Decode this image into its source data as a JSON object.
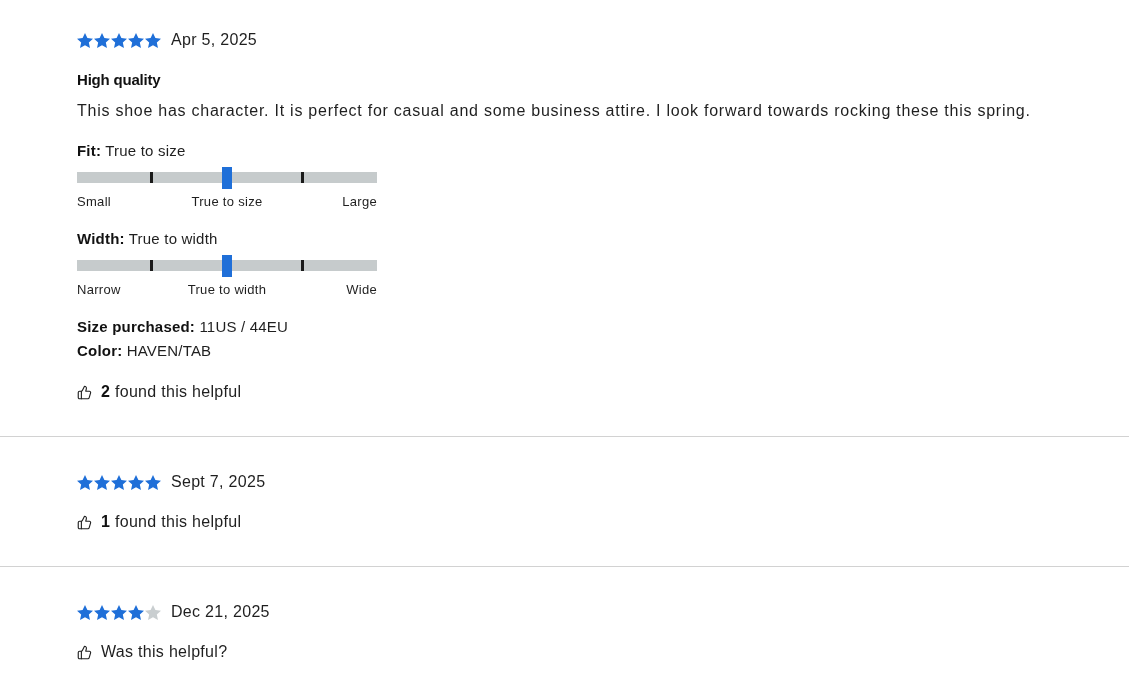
{
  "reviews": [
    {
      "stars": 5,
      "date": "Apr 5, 2025",
      "title": "High quality",
      "body": "This shoe has character. It is perfect for casual and some business attire. I look forward towards rocking these this spring.",
      "scales": [
        {
          "label": "**Fit:** True to size",
          "level": 0.5,
          "ends": [
            "Small",
            "True to size",
            "Large"
          ]
        },
        {
          "label": "**Width:** True to width",
          "level": 0.5,
          "ends": [
            "Narrow",
            "True to width",
            "Wide"
          ]
        }
      ],
      "details": [
        "**Size purchased:** 11US / 44EU",
        "**Color:** HAVEN/TAB"
      ],
      "helpful": "**2** found this helpful"
    },
    {
      "stars": 5,
      "date": "Sept 7, 2025",
      "helpful": "**1** found this helpful"
    },
    {
      "stars": 4,
      "date": "Dec 21, 2025",
      "helpful": "Was this helpful?"
    }
  ]
}
